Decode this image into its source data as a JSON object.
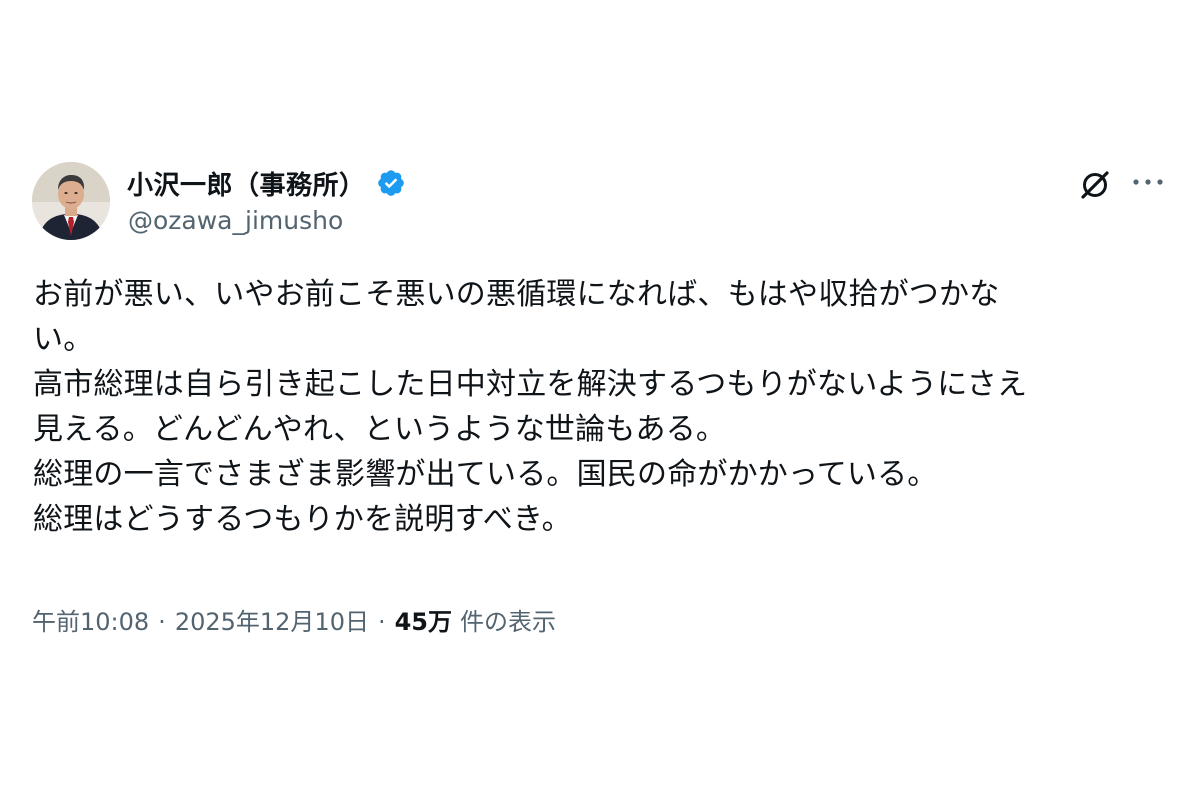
{
  "author": {
    "display_name": "小沢一郎（事務所）",
    "handle": "@ozawa_jimusho",
    "verified": true,
    "avatar_icon": "profile-photo",
    "verified_icon": "verified-badge-icon"
  },
  "actions": {
    "grok_icon": "grok-icon",
    "more_icon": "more-dots-icon"
  },
  "tweet": {
    "lines": [
      "お前が悪い、いやお前こそ悪いの悪循環になれば、もはや収拾がつかな",
      "い。",
      "高市総理は自ら引き起こした日中対立を解決するつもりがないようにさえ",
      "見える。どんどんやれ、というような世論もある。",
      "総理の一言でさまざま影響が出ている。国民の命がかかっている。",
      "総理はどうするつもりかを説明すべき。"
    ]
  },
  "meta": {
    "time": "午前10:08",
    "separator": "·",
    "date": "2025年12月10日",
    "views_count": "45万",
    "views_label": "件の表示"
  },
  "colors": {
    "text_primary": "#0f1419",
    "text_secondary": "#536471",
    "verified_blue": "#1d9bf0",
    "background": "#ffffff"
  }
}
